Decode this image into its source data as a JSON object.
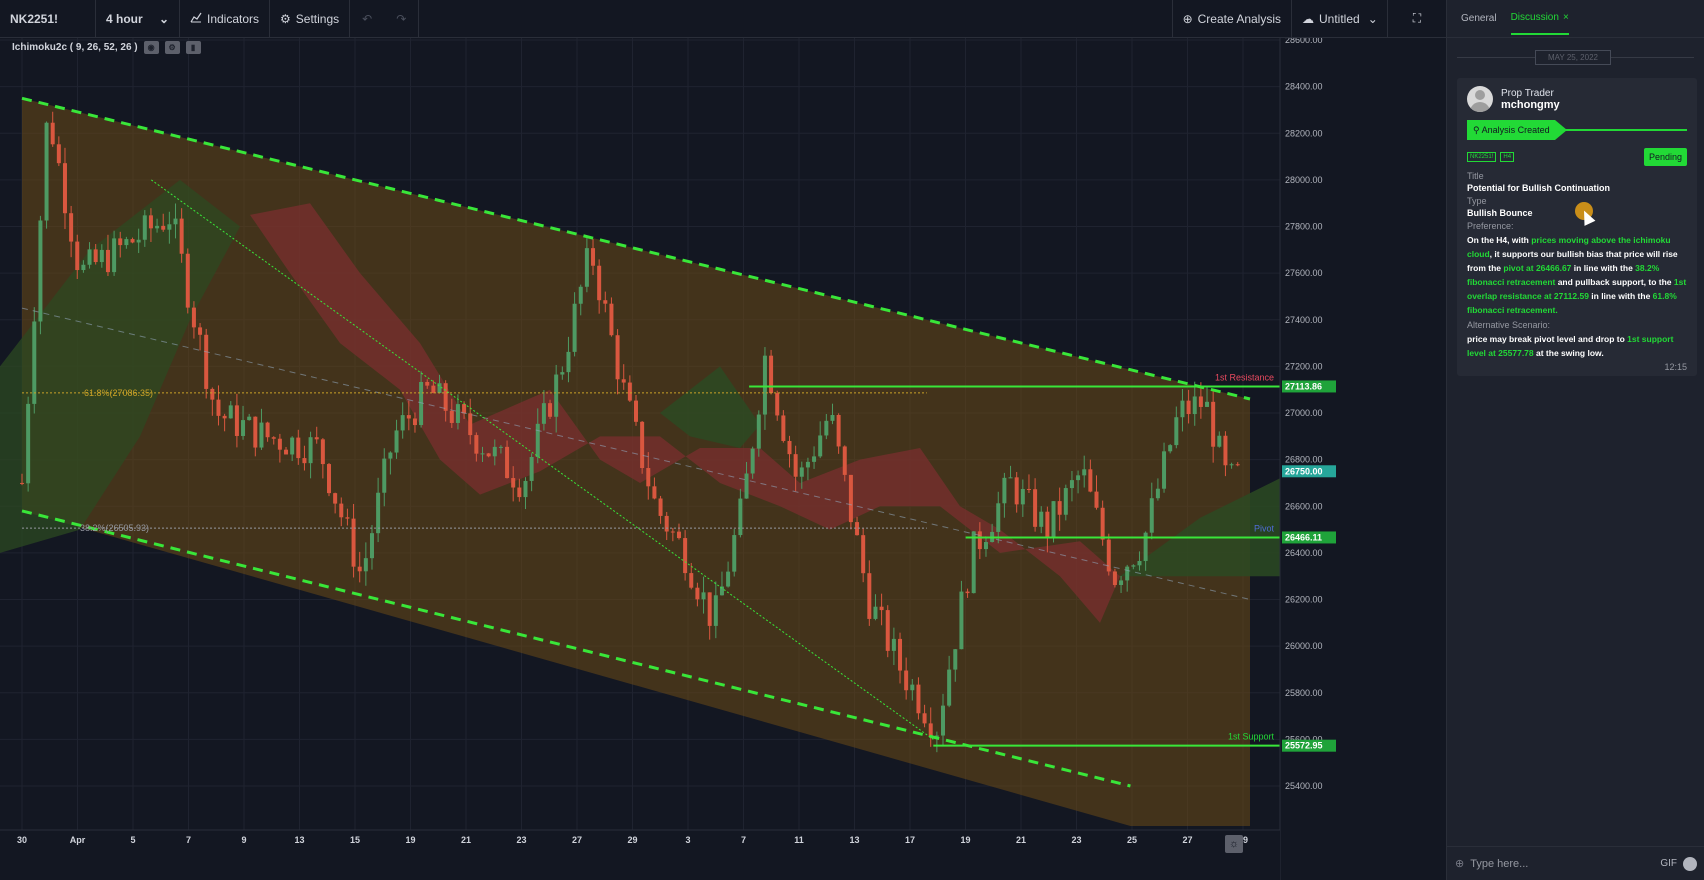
{
  "toolbar": {
    "symbol": "NK2251!",
    "interval": "4 hour",
    "indicators": "Indicators",
    "settings": "Settings",
    "create_analysis": "Create Analysis",
    "layout_name": "Untitled"
  },
  "indicator_legend": "Ichimoku2c ( 9, 26, 52, 26 )",
  "chart_data": {
    "type": "candlestick",
    "symbol": "NK2251!",
    "interval": "4 hour",
    "price_axis": {
      "min": 25400,
      "max": 28600,
      "ticks": [
        "28600.00",
        "28400.00",
        "28200.00",
        "28000.00",
        "27800.00",
        "27600.00",
        "27400.00",
        "27200.00",
        "27000.00",
        "26800.00",
        "26600.00",
        "26400.00",
        "26200.00",
        "26000.00",
        "25800.00",
        "25600.00",
        "25400.00"
      ]
    },
    "time_axis": [
      "30",
      "Apr",
      "5",
      "7",
      "9",
      "13",
      "15",
      "19",
      "21",
      "23",
      "27",
      "29",
      "3",
      "7",
      "11",
      "13",
      "17",
      "19",
      "21",
      "23",
      "25",
      "27",
      "29"
    ],
    "series": [
      {
        "name": "close",
        "points": [
          {
            "x": 0,
            "y": 26700
          },
          {
            "x": 0.8,
            "y": 28300
          },
          {
            "x": 1.8,
            "y": 27600
          },
          {
            "x": 3,
            "y": 27700
          },
          {
            "x": 4.6,
            "y": 27850
          },
          {
            "x": 6,
            "y": 27000
          },
          {
            "x": 7.5,
            "y": 26900
          },
          {
            "x": 9.2,
            "y": 26850
          },
          {
            "x": 10.5,
            "y": 26300
          },
          {
            "x": 11.5,
            "y": 26900
          },
          {
            "x": 12.6,
            "y": 27100
          },
          {
            "x": 14,
            "y": 26900
          },
          {
            "x": 15.5,
            "y": 26700
          },
          {
            "x": 16.7,
            "y": 27200
          },
          {
            "x": 17.6,
            "y": 27700
          },
          {
            "x": 18.6,
            "y": 27100
          },
          {
            "x": 19.6,
            "y": 26600
          },
          {
            "x": 20.5,
            "y": 26400
          },
          {
            "x": 21.4,
            "y": 26100
          },
          {
            "x": 22.3,
            "y": 26600
          },
          {
            "x": 23,
            "y": 27250
          },
          {
            "x": 24,
            "y": 26700
          },
          {
            "x": 25,
            "y": 27000
          },
          {
            "x": 26.2,
            "y": 26200
          },
          {
            "x": 27.2,
            "y": 25900
          },
          {
            "x": 28.3,
            "y": 25650
          },
          {
            "x": 29.4,
            "y": 26400
          },
          {
            "x": 30.6,
            "y": 26700
          },
          {
            "x": 31.7,
            "y": 26500
          },
          {
            "x": 32.8,
            "y": 26750
          },
          {
            "x": 33.8,
            "y": 26300
          },
          {
            "x": 34.7,
            "y": 26450
          },
          {
            "x": 35.8,
            "y": 27000
          },
          {
            "x": 36.6,
            "y": 27050
          },
          {
            "x": 37.3,
            "y": 26700
          },
          {
            "x": 37.8,
            "y": 26750
          }
        ]
      },
      {
        "name": "upper channel",
        "points": [
          {
            "x": 0,
            "y": 28350
          },
          {
            "x": 38,
            "y": 27060
          }
        ]
      },
      {
        "name": "lower channel",
        "points": [
          {
            "x": 0,
            "y": 26580
          },
          {
            "x": 34.3,
            "y": 25400
          }
        ]
      },
      {
        "name": "1st Resistance",
        "value": 27113.86
      },
      {
        "name": "Pivot",
        "value": 26466.11
      },
      {
        "name": "1st Support",
        "value": 25572.95
      }
    ],
    "fib_levels": [
      {
        "label": "61.8%(27086.35)",
        "value": 27086.35
      },
      {
        "label": "38.2%(26505.93)",
        "value": 26505.93
      }
    ],
    "price_labels": [
      {
        "text": "27113.86",
        "value": 27113.86,
        "color": "#1fa33a"
      },
      {
        "text": "26750.00",
        "value": 26750.0,
        "color": "#26a69a"
      },
      {
        "text": "26466.11",
        "value": 26466.11,
        "color": "#1fa33a"
      },
      {
        "text": "25572.95",
        "value": 25572.95,
        "color": "#1fa33a"
      }
    ],
    "line_labels": [
      {
        "text": "1st Resistance",
        "value": 27113.86,
        "color": "#e84a5f"
      },
      {
        "text": "Pivot",
        "value": 26466.11,
        "color": "#4f6cd6"
      },
      {
        "text": "1st Support",
        "value": 25572.95,
        "color": "#22d936"
      }
    ],
    "colors": {
      "bull": "#4e9a63",
      "bear": "#d9573f",
      "channel": "#39e639",
      "cloud_bear": "#7a2f2f",
      "cloud_bull": "#2c4a22",
      "zone": "#6b4a16"
    }
  },
  "panel": {
    "tab_general": "General",
    "tab_discussion": "Discussion",
    "tab_close": "×",
    "date": "MAY 25, 2022",
    "card": {
      "role": "Prop Trader",
      "username": "mchongmy",
      "status": "Analysis Created",
      "chip_symbol": "NK2251!",
      "chip_tf": "H4",
      "pending": "Pending",
      "title_label": "Title",
      "title": "Potential for Bullish Continuation",
      "type_label": "Type",
      "type": "Bullish Bounce",
      "pref_label": "Preference:",
      "pref": [
        {
          "t": "On the H4, with ",
          "g": false
        },
        {
          "t": "prices moving above the ichimoku cloud",
          "g": true
        },
        {
          "t": ", it supports our bullish bias that price will rise from the ",
          "g": false
        },
        {
          "t": "pivot at 26466.67",
          "g": true
        },
        {
          "t": " in line with the ",
          "g": false
        },
        {
          "t": "38.2% fibonacci retracement",
          "g": true
        },
        {
          "t": " and pullback support, to the ",
          "g": false
        },
        {
          "t": "1st overlap resistance at 27112.59",
          "g": true
        },
        {
          "t": " in line with the ",
          "g": false
        },
        {
          "t": "61.8% fibonacci retracement.",
          "g": true
        }
      ],
      "alt_label": "Alternative Scenario:",
      "alt": [
        {
          "t": "price may break pivot level and drop to ",
          "g": false
        },
        {
          "t": "1st support level at 25577.78",
          "g": true
        },
        {
          "t": " at the swing low.",
          "g": false
        }
      ],
      "time": "12:15"
    },
    "input_placeholder": "Type here...",
    "gif": "GIF"
  }
}
